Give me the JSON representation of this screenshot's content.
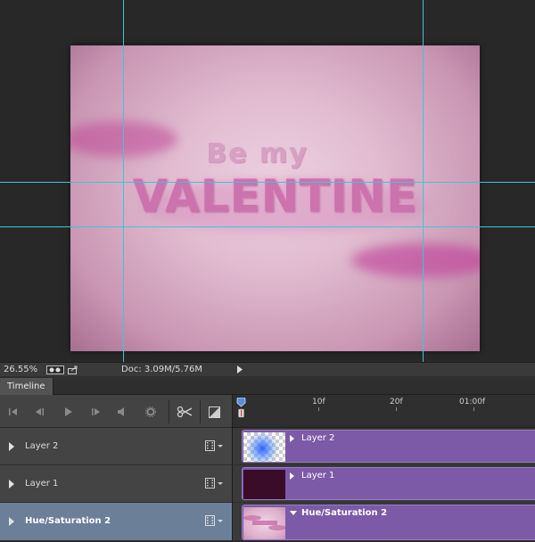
{
  "artwork": {
    "subtitle": "Be my",
    "title": "VALENTINE"
  },
  "status_bar": {
    "zoom": "26.55%",
    "doc_info": "Doc: 3.09M/5.76M"
  },
  "timeline": {
    "tab_label": "Timeline",
    "ruler_labels": [
      "10f",
      "20f",
      "01:00f"
    ],
    "layers": [
      {
        "name": "Layer 2",
        "clip_label": "Layer 2",
        "selected": false
      },
      {
        "name": "Layer 1",
        "clip_label": "Layer 1",
        "selected": false
      },
      {
        "name": "Hue/Saturation 2",
        "clip_label": "Hue/Saturation 2",
        "selected": true
      }
    ],
    "controls": [
      "go-to-first-frame-icon",
      "previous-frame-icon",
      "play-icon",
      "next-frame-icon",
      "audio-icon",
      "settings-icon",
      "split-scissors-icon",
      "transition-icon"
    ]
  },
  "colors": {
    "guide": "#41c4d8",
    "clip": "#7d5aa8",
    "selected_row": "#6b7f99"
  }
}
